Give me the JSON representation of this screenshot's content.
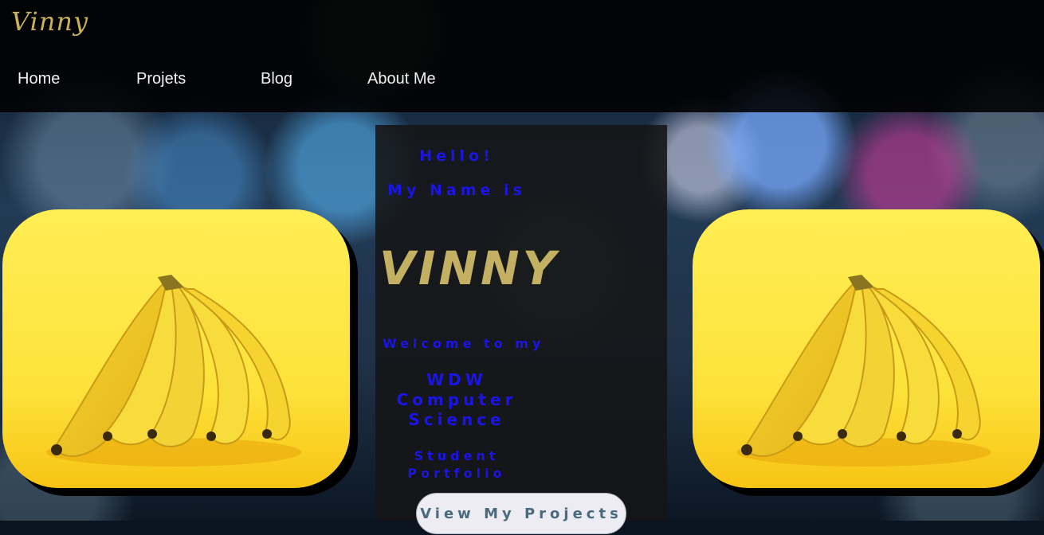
{
  "header": {
    "logo": "Vinny",
    "nav": [
      {
        "label": "Home"
      },
      {
        "label": "Projets"
      },
      {
        "label": "Blog"
      },
      {
        "label": "About Me"
      }
    ]
  },
  "hero": {
    "greeting": "Hello!",
    "name_intro": "My Name is",
    "name": "VINNY",
    "welcome": "Welcome to my",
    "course_line1": "WDW",
    "course_line2": "Computer",
    "course_line3": "Science",
    "portfolio_line1": "Student",
    "portfolio_line2": "Portfolio",
    "cta_label": "View My Projects"
  },
  "images": {
    "left": "bananas-image",
    "right": "bananas-image"
  },
  "colors": {
    "accent_gold": "#c3b062",
    "text_blue": "#1a14e6",
    "header_bg": "#000000",
    "banana_bg": "#fde73c"
  }
}
